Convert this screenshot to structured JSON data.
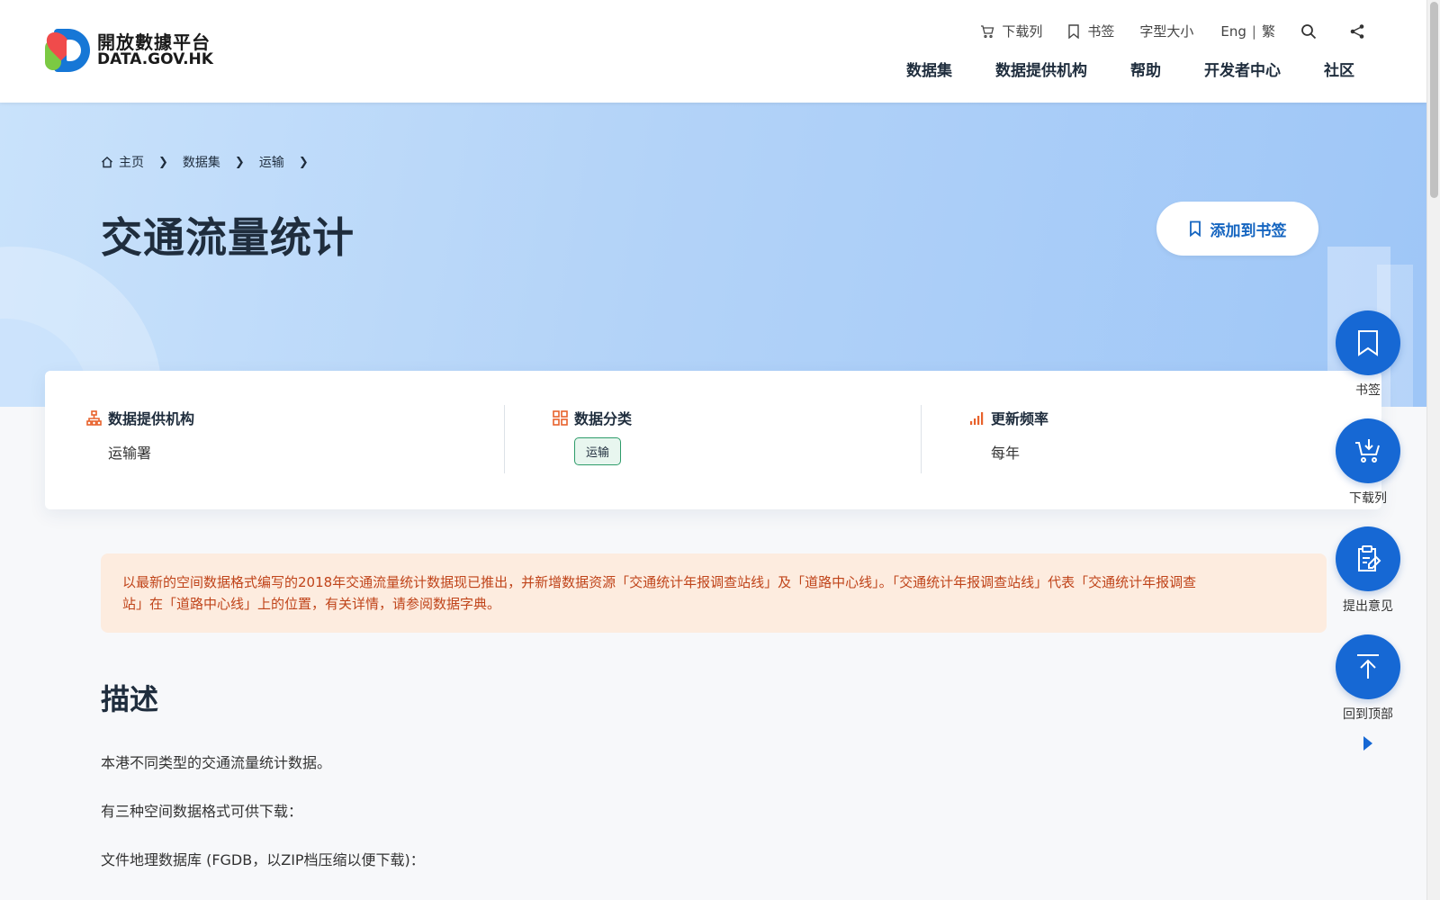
{
  "header": {
    "logo_cn": "開放數據平台",
    "logo_en": "DATA.GOV.HK",
    "utility": {
      "download_list": "下载列",
      "bookmarks": "书签",
      "font_size": "字型大小",
      "lang_en": "Eng",
      "lang_sep": "|",
      "lang_tc": "繁"
    },
    "nav": [
      "数据集",
      "数据提供机构",
      "帮助",
      "开发者中心",
      "社区"
    ]
  },
  "breadcrumb": [
    "主页",
    "数据集",
    "运输"
  ],
  "page": {
    "title": "交通流量统计",
    "bookmark_button": "添加到书签"
  },
  "info": {
    "provider_label": "数据提供机构",
    "provider_value": "运输署",
    "category_label": "数据分类",
    "category_tag": "运输",
    "frequency_label": "更新频率",
    "frequency_value": "每年"
  },
  "notice": {
    "line1": "以最新的空间数据格式编写的2018年交通流量统计数据现已推出，并新增数据资源「交通统计年报调查站线」及「道路中心线」。「交通统计年报调查站线」代表「交通统计年报调查",
    "line2": "站」在「道路中心线」上的位置，有关详情，请参阅数据字典。"
  },
  "description": {
    "title": "描述",
    "p1": "本港不同类型的交通流量统计数据。",
    "p2": "有三种空间数据格式可供下载：",
    "p3": "文件地理数据库 (FGDB，以ZIP档压缩以便下载)："
  },
  "floating": {
    "bookmark": "书签",
    "download_list": "下载列",
    "feedback": "提出意见",
    "back_to_top": "回到顶部"
  },
  "colors": {
    "primary": "#1668d4",
    "notice_bg": "#fdecdf",
    "notice_text": "#c0441a",
    "accent_orange": "#e8622c",
    "tag_green": "#2e9c6a"
  }
}
